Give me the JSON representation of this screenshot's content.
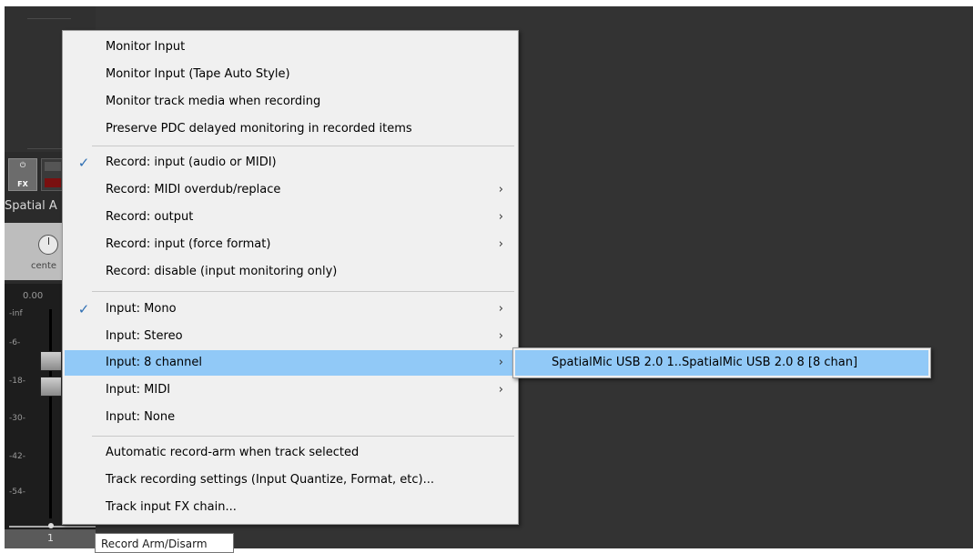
{
  "mixer": {
    "fx_power_icon": "power-icon",
    "fx_label": "FX",
    "track_name": "Spatial A",
    "pan_label": "cente",
    "volume_readout": "0.00",
    "db_scale": [
      "-inf",
      "-6-",
      "-18-",
      "-30-",
      "-42-",
      "-54-"
    ],
    "track_number": "1"
  },
  "tooltip": {
    "text": "Record Arm/Disarm"
  },
  "menu": {
    "checkmark_glyph": "✓",
    "submenu_arrow_glyph": "›",
    "items": [
      {
        "label": "Monitor Input"
      },
      {
        "label": "Monitor Input (Tape Auto Style)"
      },
      {
        "label": "Monitor track media when recording"
      },
      {
        "label": "Preserve PDC delayed monitoring in recorded items"
      },
      {
        "label": "Record: input (audio or MIDI)",
        "checked": true
      },
      {
        "label": "Record: MIDI overdub/replace",
        "submenu": true
      },
      {
        "label": "Record: output",
        "submenu": true
      },
      {
        "label": "Record: input (force format)",
        "submenu": true
      },
      {
        "label": "Record: disable (input monitoring only)"
      },
      {
        "label": "Input: Mono",
        "checked": true,
        "submenu": true
      },
      {
        "label": "Input: Stereo",
        "submenu": true
      },
      {
        "label": "Input: 8 channel",
        "submenu": true,
        "highlighted": true
      },
      {
        "label": "Input: MIDI",
        "submenu": true
      },
      {
        "label": "Input: None"
      },
      {
        "label": "Automatic record-arm when track selected"
      },
      {
        "label": "Track recording settings (Input Quantize, Format, etc)..."
      },
      {
        "label": "Track input FX chain..."
      }
    ]
  },
  "submenu": {
    "items": [
      {
        "label": "SpatialMic USB 2.0 1..SpatialMic USB 2.0 8 [8 chan]",
        "highlighted": true
      }
    ]
  },
  "colors": {
    "highlight": "#91c9f7",
    "menu_bg": "#f0f0f0",
    "workspace": "#333333",
    "checkmark": "#2f6fb3"
  }
}
